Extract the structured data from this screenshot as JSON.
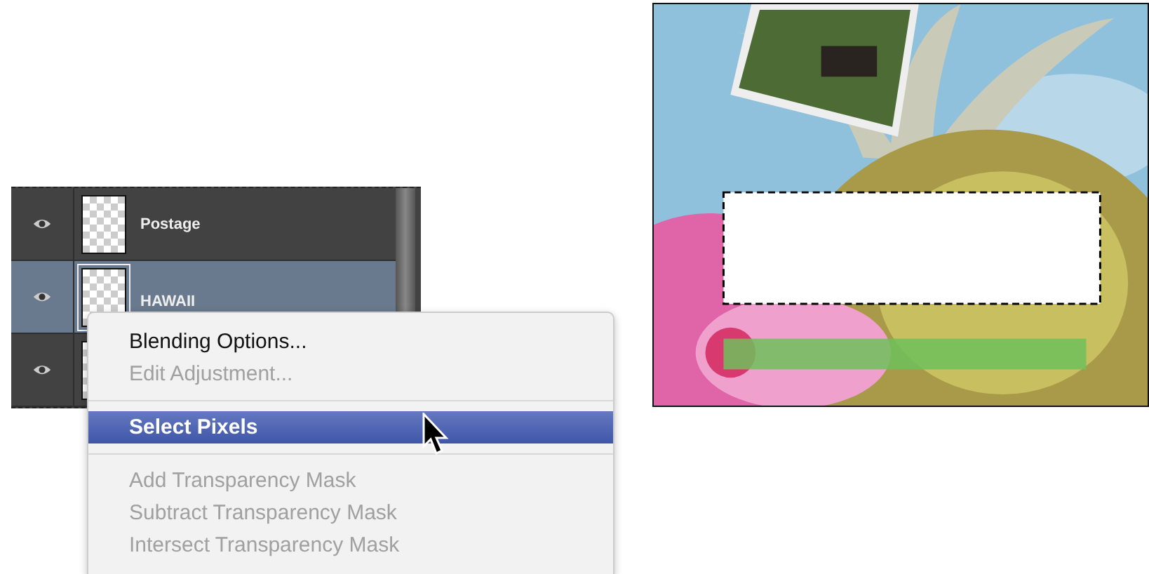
{
  "layers_panel": {
    "layers": [
      {
        "name": "Postage",
        "visible": true,
        "selected": false
      },
      {
        "name": "HAWAII",
        "visible": true,
        "selected": true
      },
      {
        "visible": true,
        "selected": false
      }
    ]
  },
  "context_menu": {
    "items": [
      {
        "kind": "item",
        "label": "Blending Options...",
        "disabled": false,
        "selected": false
      },
      {
        "kind": "item",
        "label": "Edit Adjustment...",
        "disabled": true,
        "selected": false
      },
      {
        "kind": "separator"
      },
      {
        "kind": "item",
        "label": "Select Pixels",
        "disabled": false,
        "selected": true
      },
      {
        "kind": "separator"
      },
      {
        "kind": "item",
        "label": "Add Transparency Mask",
        "disabled": true,
        "selected": false
      },
      {
        "kind": "item",
        "label": "Subtract Transparency Mask",
        "disabled": true,
        "selected": false
      },
      {
        "kind": "item",
        "label": "Intersect Transparency Mask",
        "disabled": true,
        "selected": false
      }
    ]
  }
}
